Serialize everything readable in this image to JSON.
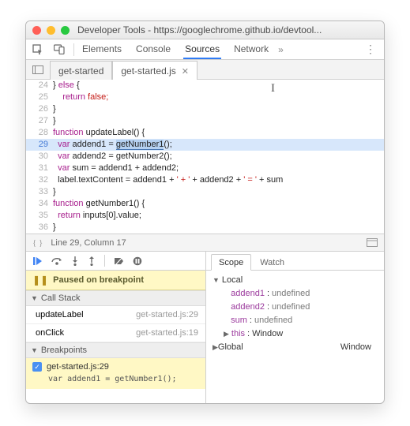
{
  "window": {
    "title": "Developer Tools - https://googlechrome.github.io/devtool..."
  },
  "main_tabs": {
    "t0": "Elements",
    "t1": "Console",
    "t2": "Sources",
    "t3": "Network"
  },
  "file_tabs": {
    "f0": "get-started",
    "f1": "get-started.js"
  },
  "code": {
    "lines": [
      {
        "n": "24",
        "t": "} else {"
      },
      {
        "n": "25",
        "t": "    return false;",
        "kw": "return",
        "rest": " false;"
      },
      {
        "n": "26",
        "t": "}"
      },
      {
        "n": "27",
        "t": "}"
      },
      {
        "n": "28",
        "t": "function updateLabel() {",
        "kw": "function",
        "name": " updateLabel() {"
      },
      {
        "n": "29",
        "pre": "  var addend1 = ",
        "sel": "getNumber1",
        "post": "();",
        "kw": "var"
      },
      {
        "n": "30",
        "t": "  var addend2 = getNumber2();",
        "kw": "var",
        "rest": " addend2 = getNumber2();"
      },
      {
        "n": "31",
        "t": "  var sum = addend1 + addend2;",
        "kw": "var",
        "rest": " sum = addend1 + addend2;"
      },
      {
        "n": "32",
        "pre": "  label.textContent = addend1 + ",
        "s1": "' + '",
        "mid": " + addend2 + ",
        "s2": "' = '",
        "post": " + sum"
      },
      {
        "n": "33",
        "t": "}"
      },
      {
        "n": "34",
        "t": "function getNumber1() {",
        "kw": "function",
        "name": " getNumber1() {"
      },
      {
        "n": "35",
        "t": "  return inputs[0].value;",
        "kw": "return",
        "rest": " inputs[0].value;"
      },
      {
        "n": "36",
        "t": "}"
      }
    ]
  },
  "status": {
    "text": "Line 29, Column 17"
  },
  "paused_msg": "Paused on breakpoint",
  "sections": {
    "callstack": "Call Stack",
    "breakpoints": "Breakpoints"
  },
  "callstack": [
    {
      "fn": "updateLabel",
      "loc": "get-started.js:29"
    },
    {
      "fn": "onClick",
      "loc": "get-started.js:19"
    }
  ],
  "breakpoints": [
    {
      "label": "get-started.js:29",
      "code": "var addend1 = getNumber1();"
    }
  ],
  "scope_tabs": {
    "s0": "Scope",
    "s1": "Watch"
  },
  "scope": {
    "local_label": "Local",
    "vars": [
      {
        "k": "addend1",
        "v": "undefined"
      },
      {
        "k": "addend2",
        "v": "undefined"
      },
      {
        "k": "sum",
        "v": "undefined"
      }
    ],
    "this_label": "this",
    "this_val": "Window",
    "global_label": "Global",
    "global_val": "Window"
  }
}
